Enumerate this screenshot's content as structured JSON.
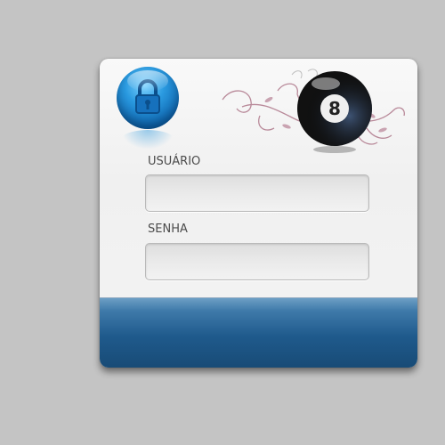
{
  "login": {
    "username_label": "USUÁRIO",
    "username_value": "",
    "password_label": "SENHA",
    "password_value": ""
  },
  "icons": {
    "lock": "padlock-icon",
    "logo": "eight-ball-icon",
    "decoration": "floral-swirl-ornament"
  },
  "colors": {
    "accent_blue": "#1f5a8c",
    "lock_blue": "#2a9ae0",
    "background": "#c4c4c4"
  }
}
